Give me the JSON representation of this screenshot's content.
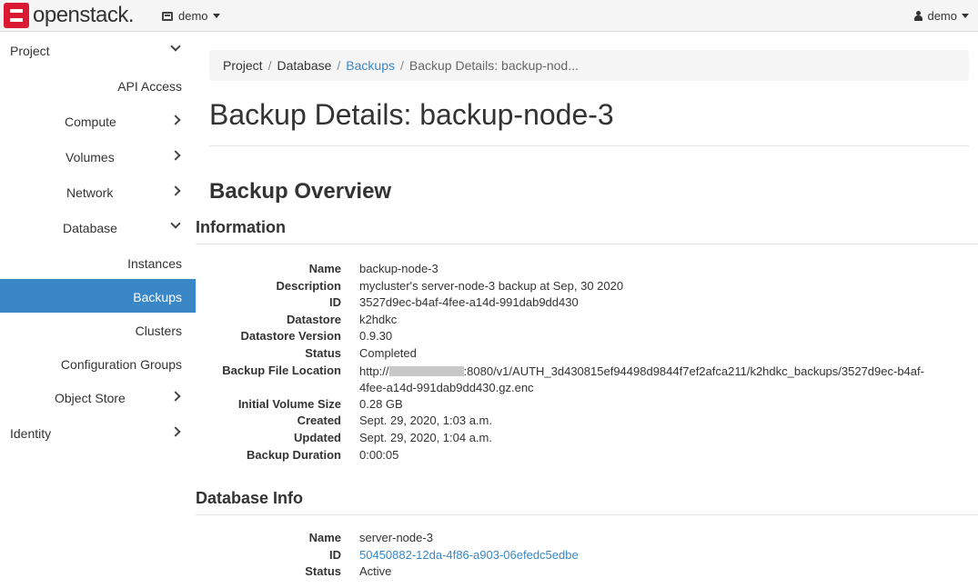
{
  "brand": {
    "name": "openstack."
  },
  "topbar": {
    "project": "demo",
    "user": "demo"
  },
  "sidebar": {
    "items": [
      {
        "label": "Project",
        "chevron": "down"
      },
      {
        "label": "API Access"
      },
      {
        "label": "Compute",
        "chevron": "right"
      },
      {
        "label": "Volumes",
        "chevron": "right"
      },
      {
        "label": "Network",
        "chevron": "right"
      },
      {
        "label": "Database",
        "chevron": "down"
      },
      {
        "label": "Instances"
      },
      {
        "label": "Backups",
        "active": true
      },
      {
        "label": "Clusters"
      },
      {
        "label": "Configuration Groups"
      },
      {
        "label": "Object Store",
        "chevron": "right"
      },
      {
        "label": "Identity",
        "chevron": "right"
      }
    ]
  },
  "breadcrumb": {
    "items": [
      "Project",
      "Database",
      "Backups",
      "Backup Details: backup-nod..."
    ]
  },
  "page": {
    "title": "Backup Details: backup-node-3",
    "overview_heading": "Backup Overview",
    "info_heading": "Information",
    "dbinfo_heading": "Database Info"
  },
  "information": [
    {
      "label": "Name",
      "value": "backup-node-3"
    },
    {
      "label": "Description",
      "value": "mycluster's server-node-3 backup at Sep, 30 2020"
    },
    {
      "label": "ID",
      "value": "3527d9ec-b4af-4fee-a14d-991dab9dd430"
    },
    {
      "label": "Datastore",
      "value": "k2hdkc"
    },
    {
      "label": "Datastore Version",
      "value": "0.9.30"
    },
    {
      "label": "Status",
      "value": "Completed"
    },
    {
      "label": "Backup File Location",
      "value_prefix": "http://",
      "value_suffix": ":8080/v1/AUTH_3d430815ef94498d9844f7ef2afca211/k2hdkc_backups/3527d9ec-b4af-4fee-a14d-991dab9dd430.gz.enc"
    },
    {
      "label": "Initial Volume Size",
      "value": "0.28 GB"
    },
    {
      "label": "Created",
      "value": "Sept. 29, 2020, 1:03 a.m."
    },
    {
      "label": "Updated",
      "value": "Sept. 29, 2020, 1:04 a.m."
    },
    {
      "label": "Backup Duration",
      "value": "0:00:05"
    }
  ],
  "database_info": [
    {
      "label": "Name",
      "value": "server-node-3"
    },
    {
      "label": "ID",
      "value": "50450882-12da-4f86-a903-06efedc5edbe"
    },
    {
      "label": "Status",
      "value": "Active"
    }
  ],
  "colors": {
    "accent": "#3a87c8",
    "brand_red": "#da1a32"
  }
}
